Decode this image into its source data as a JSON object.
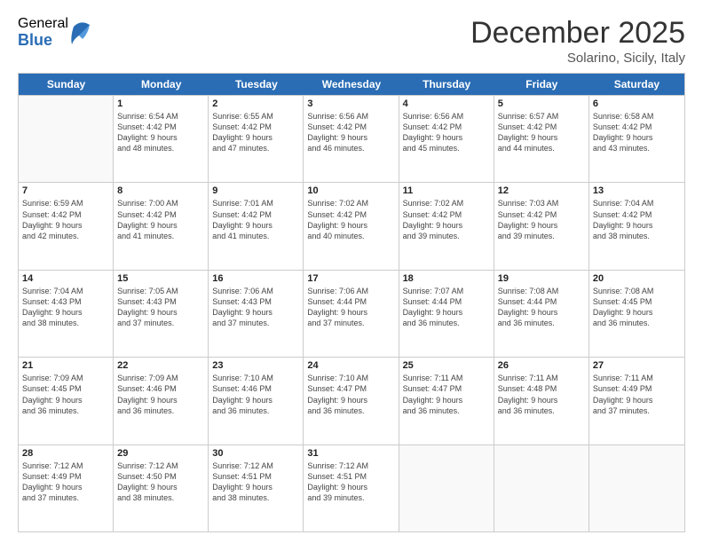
{
  "logo": {
    "general": "General",
    "blue": "Blue"
  },
  "header": {
    "month": "December 2025",
    "location": "Solarino, Sicily, Italy"
  },
  "days": [
    "Sunday",
    "Monday",
    "Tuesday",
    "Wednesday",
    "Thursday",
    "Friday",
    "Saturday"
  ],
  "weeks": [
    [
      {
        "day": "",
        "lines": []
      },
      {
        "day": "1",
        "lines": [
          "Sunrise: 6:54 AM",
          "Sunset: 4:42 PM",
          "Daylight: 9 hours",
          "and 48 minutes."
        ]
      },
      {
        "day": "2",
        "lines": [
          "Sunrise: 6:55 AM",
          "Sunset: 4:42 PM",
          "Daylight: 9 hours",
          "and 47 minutes."
        ]
      },
      {
        "day": "3",
        "lines": [
          "Sunrise: 6:56 AM",
          "Sunset: 4:42 PM",
          "Daylight: 9 hours",
          "and 46 minutes."
        ]
      },
      {
        "day": "4",
        "lines": [
          "Sunrise: 6:56 AM",
          "Sunset: 4:42 PM",
          "Daylight: 9 hours",
          "and 45 minutes."
        ]
      },
      {
        "day": "5",
        "lines": [
          "Sunrise: 6:57 AM",
          "Sunset: 4:42 PM",
          "Daylight: 9 hours",
          "and 44 minutes."
        ]
      },
      {
        "day": "6",
        "lines": [
          "Sunrise: 6:58 AM",
          "Sunset: 4:42 PM",
          "Daylight: 9 hours",
          "and 43 minutes."
        ]
      }
    ],
    [
      {
        "day": "7",
        "lines": [
          "Sunrise: 6:59 AM",
          "Sunset: 4:42 PM",
          "Daylight: 9 hours",
          "and 42 minutes."
        ]
      },
      {
        "day": "8",
        "lines": [
          "Sunrise: 7:00 AM",
          "Sunset: 4:42 PM",
          "Daylight: 9 hours",
          "and 41 minutes."
        ]
      },
      {
        "day": "9",
        "lines": [
          "Sunrise: 7:01 AM",
          "Sunset: 4:42 PM",
          "Daylight: 9 hours",
          "and 41 minutes."
        ]
      },
      {
        "day": "10",
        "lines": [
          "Sunrise: 7:02 AM",
          "Sunset: 4:42 PM",
          "Daylight: 9 hours",
          "and 40 minutes."
        ]
      },
      {
        "day": "11",
        "lines": [
          "Sunrise: 7:02 AM",
          "Sunset: 4:42 PM",
          "Daylight: 9 hours",
          "and 39 minutes."
        ]
      },
      {
        "day": "12",
        "lines": [
          "Sunrise: 7:03 AM",
          "Sunset: 4:42 PM",
          "Daylight: 9 hours",
          "and 39 minutes."
        ]
      },
      {
        "day": "13",
        "lines": [
          "Sunrise: 7:04 AM",
          "Sunset: 4:42 PM",
          "Daylight: 9 hours",
          "and 38 minutes."
        ]
      }
    ],
    [
      {
        "day": "14",
        "lines": [
          "Sunrise: 7:04 AM",
          "Sunset: 4:43 PM",
          "Daylight: 9 hours",
          "and 38 minutes."
        ]
      },
      {
        "day": "15",
        "lines": [
          "Sunrise: 7:05 AM",
          "Sunset: 4:43 PM",
          "Daylight: 9 hours",
          "and 37 minutes."
        ]
      },
      {
        "day": "16",
        "lines": [
          "Sunrise: 7:06 AM",
          "Sunset: 4:43 PM",
          "Daylight: 9 hours",
          "and 37 minutes."
        ]
      },
      {
        "day": "17",
        "lines": [
          "Sunrise: 7:06 AM",
          "Sunset: 4:44 PM",
          "Daylight: 9 hours",
          "and 37 minutes."
        ]
      },
      {
        "day": "18",
        "lines": [
          "Sunrise: 7:07 AM",
          "Sunset: 4:44 PM",
          "Daylight: 9 hours",
          "and 36 minutes."
        ]
      },
      {
        "day": "19",
        "lines": [
          "Sunrise: 7:08 AM",
          "Sunset: 4:44 PM",
          "Daylight: 9 hours",
          "and 36 minutes."
        ]
      },
      {
        "day": "20",
        "lines": [
          "Sunrise: 7:08 AM",
          "Sunset: 4:45 PM",
          "Daylight: 9 hours",
          "and 36 minutes."
        ]
      }
    ],
    [
      {
        "day": "21",
        "lines": [
          "Sunrise: 7:09 AM",
          "Sunset: 4:45 PM",
          "Daylight: 9 hours",
          "and 36 minutes."
        ]
      },
      {
        "day": "22",
        "lines": [
          "Sunrise: 7:09 AM",
          "Sunset: 4:46 PM",
          "Daylight: 9 hours",
          "and 36 minutes."
        ]
      },
      {
        "day": "23",
        "lines": [
          "Sunrise: 7:10 AM",
          "Sunset: 4:46 PM",
          "Daylight: 9 hours",
          "and 36 minutes."
        ]
      },
      {
        "day": "24",
        "lines": [
          "Sunrise: 7:10 AM",
          "Sunset: 4:47 PM",
          "Daylight: 9 hours",
          "and 36 minutes."
        ]
      },
      {
        "day": "25",
        "lines": [
          "Sunrise: 7:11 AM",
          "Sunset: 4:47 PM",
          "Daylight: 9 hours",
          "and 36 minutes."
        ]
      },
      {
        "day": "26",
        "lines": [
          "Sunrise: 7:11 AM",
          "Sunset: 4:48 PM",
          "Daylight: 9 hours",
          "and 36 minutes."
        ]
      },
      {
        "day": "27",
        "lines": [
          "Sunrise: 7:11 AM",
          "Sunset: 4:49 PM",
          "Daylight: 9 hours",
          "and 37 minutes."
        ]
      }
    ],
    [
      {
        "day": "28",
        "lines": [
          "Sunrise: 7:12 AM",
          "Sunset: 4:49 PM",
          "Daylight: 9 hours",
          "and 37 minutes."
        ]
      },
      {
        "day": "29",
        "lines": [
          "Sunrise: 7:12 AM",
          "Sunset: 4:50 PM",
          "Daylight: 9 hours",
          "and 38 minutes."
        ]
      },
      {
        "day": "30",
        "lines": [
          "Sunrise: 7:12 AM",
          "Sunset: 4:51 PM",
          "Daylight: 9 hours",
          "and 38 minutes."
        ]
      },
      {
        "day": "31",
        "lines": [
          "Sunrise: 7:12 AM",
          "Sunset: 4:51 PM",
          "Daylight: 9 hours",
          "and 39 minutes."
        ]
      },
      {
        "day": "",
        "lines": []
      },
      {
        "day": "",
        "lines": []
      },
      {
        "day": "",
        "lines": []
      }
    ]
  ]
}
